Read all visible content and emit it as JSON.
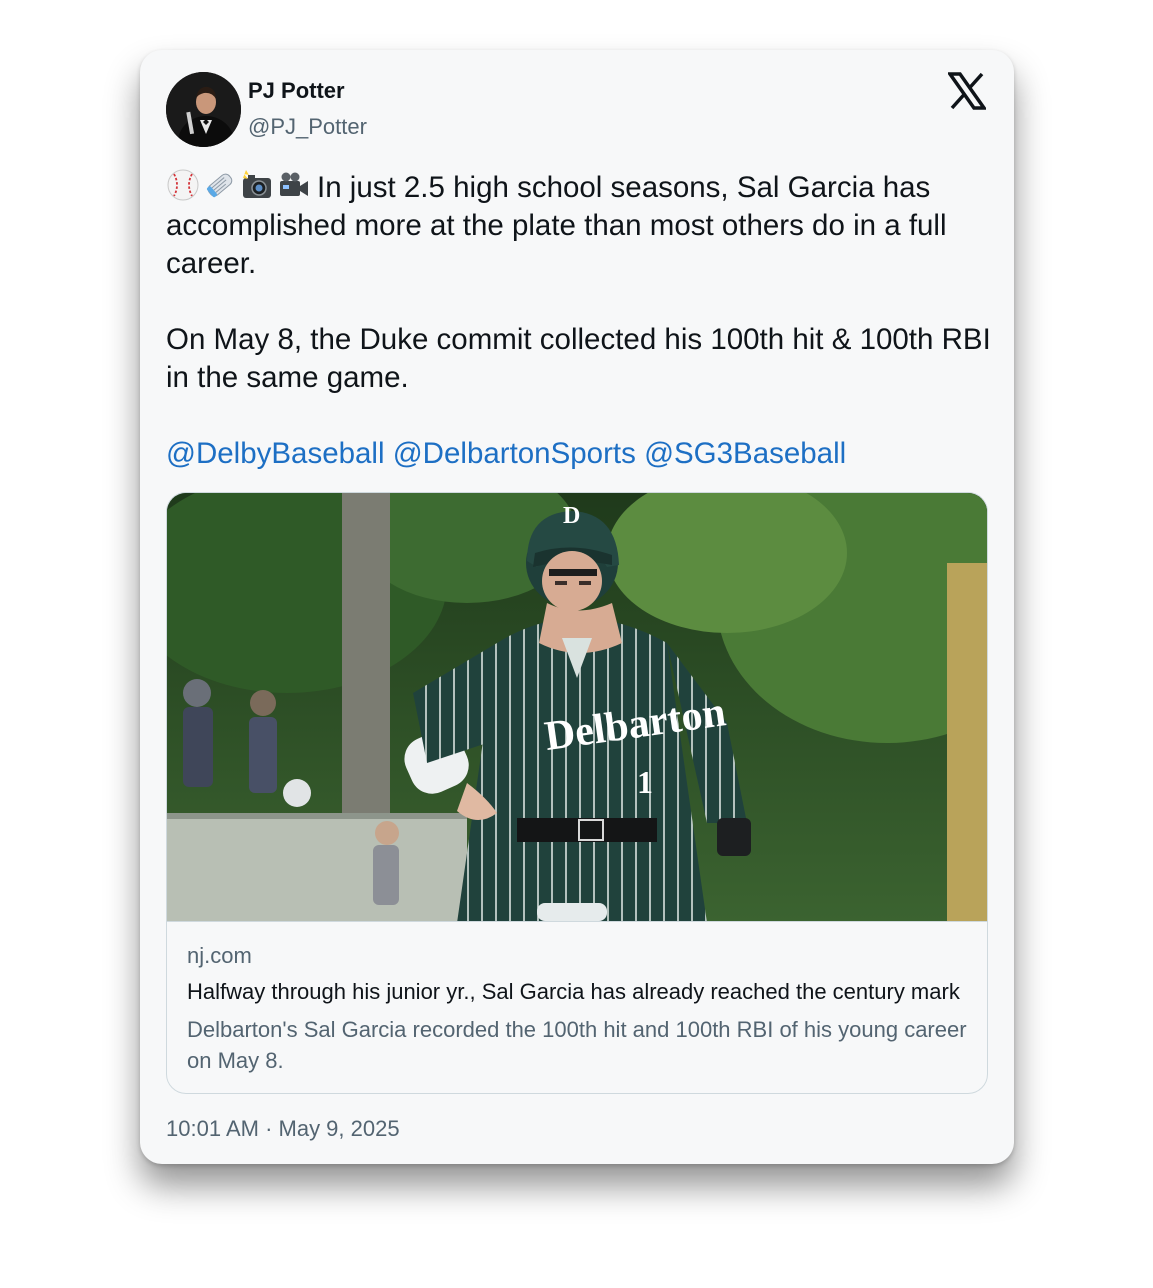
{
  "author": {
    "name": "PJ Potter",
    "handle": "@PJ_Potter"
  },
  "icons": [
    "baseball-emoji",
    "newspaper-emoji",
    "camera-flash-emoji",
    "video-camera-emoji",
    "x-logo-icon"
  ],
  "tweet": {
    "line1": "In just 2.5 high school seasons, Sal Garcia has accomplished more at the plate than most others do in a full career.",
    "line2": "On May 8, the Duke commit collected his 100th hit & 100th RBI in the same game.",
    "mentions": [
      "@DelbyBaseball",
      "@DelbartonSports",
      "@SG3Baseball"
    ],
    "mention_color": "#1d6fc4"
  },
  "link_card": {
    "domain": "nj.com",
    "title": "Halfway through his junior yr., Sal Garcia has already reached the century mark",
    "description": "Delbarton's Sal Garcia recorded the 100th hit and 100th RBI of his young career on May 8.",
    "image": {
      "helmet_letter": "D",
      "jersey_text": "Delbarton",
      "jersey_number": "1"
    }
  },
  "timestamp": "10:01 AM · May 9, 2025"
}
